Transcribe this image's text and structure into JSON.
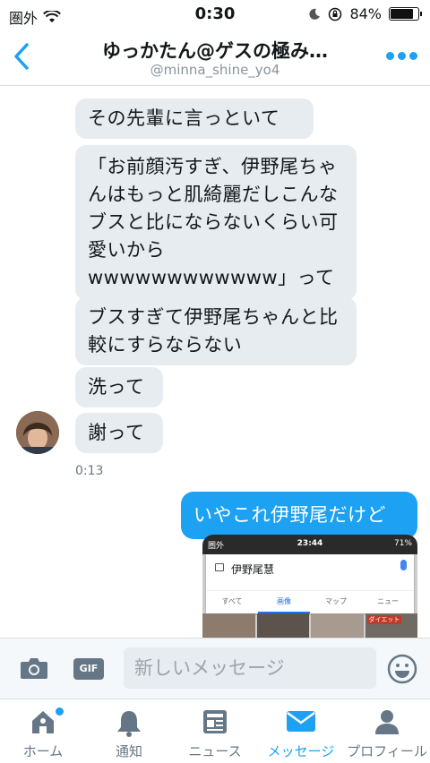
{
  "status_bar": {
    "carrier": "圏外",
    "time": "0:30",
    "battery": "84%",
    "battery_level": 0.84
  },
  "header": {
    "title": "ゆっかたん@ゲスの極み…",
    "handle": "@minna_shine_yo4"
  },
  "messages": [
    {
      "text": "その先輩に言っといて",
      "direction": "incoming"
    },
    {
      "text": "「お前顔汚すぎ、伊野尾ちゃんはもっと肌綺麗だしこんなブスと比にならないくらい可愛いからwwwwwwwwwwww」って",
      "direction": "incoming"
    },
    {
      "text": "ブスすぎて伊野尾ちゃんと比較にすらならない",
      "direction": "incoming"
    },
    {
      "text": "洗って",
      "direction": "incoming"
    },
    {
      "text": "謝って",
      "direction": "incoming"
    },
    {
      "text": "いやこれ伊野尾だけど",
      "direction": "outgoing"
    }
  ],
  "timestamp": "0:13",
  "attachment": {
    "carrier": "圏外",
    "time": "23:44",
    "battery": "71%",
    "search_query": "伊野尾慧",
    "tabs": [
      "すべて",
      "画像",
      "マップ",
      "ニュー"
    ],
    "active_tab": "画像",
    "caption": "ダイエット"
  },
  "composer": {
    "placeholder": "新しいメッセージ",
    "gif_label": "GIF"
  },
  "tabbar": {
    "items": [
      {
        "label": "ホーム",
        "icon": "home-icon"
      },
      {
        "label": "通知",
        "icon": "bell-icon"
      },
      {
        "label": "ニュース",
        "icon": "news-icon"
      },
      {
        "label": "メッセージ",
        "icon": "envelope-icon"
      },
      {
        "label": "プロフィール",
        "icon": "person-icon"
      }
    ],
    "active": "メッセージ"
  },
  "colors": {
    "accent": "#1da1f2",
    "bubble_incoming": "#e6ecf0",
    "inactive_icon": "#657786"
  }
}
